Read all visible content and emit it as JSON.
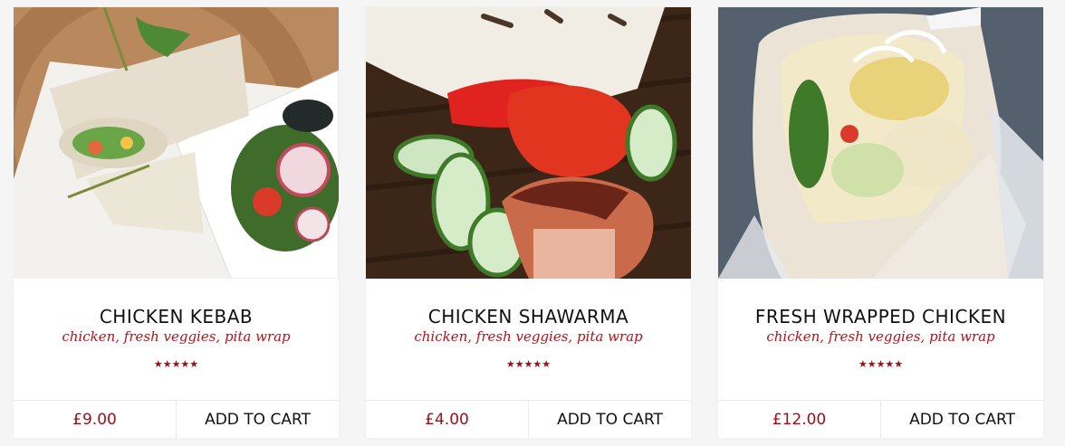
{
  "products": [
    {
      "title": "CHICKEN KEBAB",
      "subtitle": "chicken, fresh veggies, pita wrap",
      "rating_stars": "★★★★★",
      "rating": 5,
      "price": "£9.00",
      "cart_label": "ADD TO CART"
    },
    {
      "title": "CHICKEN SHAWARMA",
      "subtitle": "chicken, fresh veggies, pita wrap",
      "rating_stars": "★★★★★",
      "rating": 5,
      "price": "£4.00",
      "cart_label": "ADD TO CART"
    },
    {
      "title": "FRESH WRAPPED CHICKEN",
      "subtitle": "chicken, fresh veggies, pita wrap",
      "rating_stars": "★★★★★",
      "rating": 5,
      "price": "£12.00",
      "cart_label": "ADD TO CART"
    }
  ],
  "colors": {
    "accent": "#a00d16",
    "subtitle": "#b5121b",
    "title": "#111111",
    "card_bg": "#ffffff",
    "page_bg": "#f5f5f5"
  }
}
